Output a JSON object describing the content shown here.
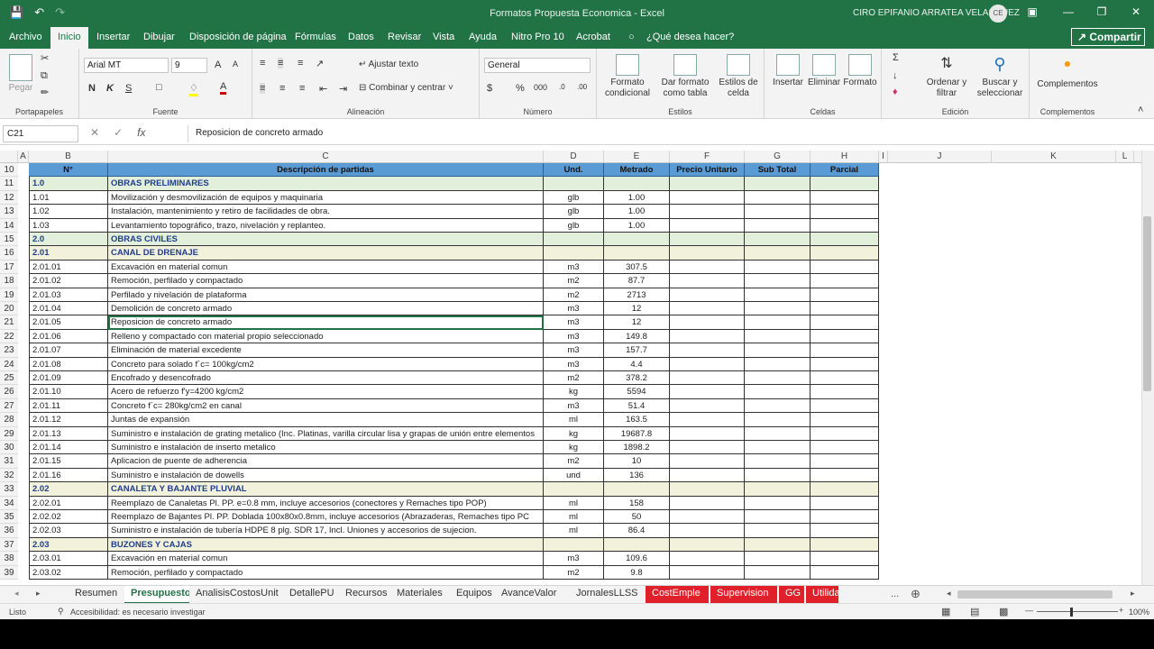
{
  "window": {
    "title": "Formatos Propuesta Economica  -  Excel",
    "user": "CIRO EPIFANIO ARRATEA VELASQUEZ",
    "initials": "CE"
  },
  "tabs": [
    "Archivo",
    "Inicio",
    "Insertar",
    "Dibujar",
    "Disposición de página",
    "Fórmulas",
    "Datos",
    "Revisar",
    "Vista",
    "Ayuda",
    "Nitro Pro 10",
    "Acrobat",
    "¿Qué desea hacer?"
  ],
  "share": "Compartir",
  "ribbon": {
    "clipboard": {
      "paste": "Pegar",
      "label": "Portapapeles"
    },
    "font": {
      "name": "Arial MT",
      "size": "9",
      "bold": "N",
      "italic": "K",
      "underline": "S",
      "label": "Fuente"
    },
    "align": {
      "wrap": "Ajustar texto",
      "merge": "Combinar y centrar",
      "label": "Alineación"
    },
    "number": {
      "format": "General",
      "label": "Número"
    },
    "styles": {
      "cond": "Formato condicional",
      "table": "Dar formato como tabla",
      "cell": "Estilos de celda",
      "label": "Estilos"
    },
    "cells": {
      "insert": "Insertar",
      "delete": "Eliminar",
      "format": "Formato",
      "label": "Celdas"
    },
    "editing": {
      "sort": "Ordenar y filtrar",
      "find": "Buscar y seleccionar",
      "label": "Edición"
    },
    "addins": {
      "btn": "Complementos",
      "label": "Complementos"
    }
  },
  "namebox": "C21",
  "formula": "Reposicion de concreto armado",
  "columns": [
    "A",
    "B",
    "C",
    "D",
    "E",
    "F",
    "G",
    "H",
    "I",
    "J",
    "K",
    "L"
  ],
  "header": {
    "num": "N°",
    "desc": "Descripción de partidas",
    "und": "Und.",
    "met": "Metrado",
    "pu": "Precio Unitario",
    "st": "Sub Total",
    "par": "Parcial"
  },
  "rows": [
    {
      "r": "11",
      "n": "1.0",
      "d": "OBRAS PRELIMINARES",
      "u": "",
      "m": "",
      "t": "sec"
    },
    {
      "r": "12",
      "n": "1.01",
      "d": "Movilización y desmovilización de equipos y maquinaria",
      "u": "glb",
      "m": "1.00",
      "t": ""
    },
    {
      "r": "13",
      "n": "1.02",
      "d": "Instalación, mantenimiento y retiro de facilidades de obra.",
      "u": "glb",
      "m": "1.00",
      "t": ""
    },
    {
      "r": "14",
      "n": "1.03",
      "d": "Levantamiento topográfico, trazo, nivelación y replanteo.",
      "u": "glb",
      "m": "1.00",
      "t": ""
    },
    {
      "r": "15",
      "n": "2.0",
      "d": "OBRAS CIVILES",
      "u": "",
      "m": "",
      "t": "sec"
    },
    {
      "r": "16",
      "n": "2.01",
      "d": "CANAL DE DRENAJE",
      "u": "",
      "m": "",
      "t": "sub"
    },
    {
      "r": "17",
      "n": "2.01.01",
      "d": "Excavación en material comun",
      "u": "m3",
      "m": "307.5",
      "t": ""
    },
    {
      "r": "18",
      "n": "2.01.02",
      "d": "Remoción, perfilado y compactado",
      "u": "m2",
      "m": "87.7",
      "t": ""
    },
    {
      "r": "19",
      "n": "2.01.03",
      "d": "Perfilado y nivelación de plataforma",
      "u": "m2",
      "m": "2713",
      "t": ""
    },
    {
      "r": "20",
      "n": "2.01.04",
      "d": "Demolición de concreto armado",
      "u": "m3",
      "m": "12",
      "t": ""
    },
    {
      "r": "21",
      "n": "2.01.05",
      "d": "Reposicion de concreto armado",
      "u": "m3",
      "m": "12",
      "t": ""
    },
    {
      "r": "22",
      "n": "2.01.06",
      "d": "Relleno y compactado con material propio seleccionado",
      "u": "m3",
      "m": "149.8",
      "t": ""
    },
    {
      "r": "23",
      "n": "2.01.07",
      "d": "Eliminación de material excedente",
      "u": "m3",
      "m": "157.7",
      "t": ""
    },
    {
      "r": "24",
      "n": "2.01.08",
      "d": "Concreto para solado f´c= 100kg/cm2",
      "u": "m3",
      "m": "4.4",
      "t": ""
    },
    {
      "r": "25",
      "n": "2.01.09",
      "d": "Encofrado y desencofrado",
      "u": "m2",
      "m": "378.2",
      "t": ""
    },
    {
      "r": "26",
      "n": "2.01.10",
      "d": "Acero de refuerzo f'y=4200 kg/cm2",
      "u": "kg",
      "m": "5594",
      "t": ""
    },
    {
      "r": "27",
      "n": "2.01.11",
      "d": "Concreto f´c= 280kg/cm2 en canal",
      "u": "m3",
      "m": "51.4",
      "t": ""
    },
    {
      "r": "28",
      "n": "2.01.12",
      "d": "Juntas de expansión",
      "u": "ml",
      "m": "163.5",
      "t": ""
    },
    {
      "r": "29",
      "n": "2.01.13",
      "d": "Suministro e instalación de grating metalico (Inc. Platinas, varilla circular lisa y grapas de unión entre elementos",
      "u": "kg",
      "m": "19687.8",
      "t": ""
    },
    {
      "r": "30",
      "n": "2.01.14",
      "d": "Suministro e instalación de inserto metalico",
      "u": "kg",
      "m": "1898.2",
      "t": ""
    },
    {
      "r": "31",
      "n": "2.01.15",
      "d": "Aplicacion de puente de adherencia",
      "u": "m2",
      "m": "10",
      "t": ""
    },
    {
      "r": "32",
      "n": "2.01.16",
      "d": "Suministro e instalación de dowells",
      "u": "und",
      "m": "136",
      "t": ""
    },
    {
      "r": "33",
      "n": "2.02",
      "d": "CANALETA Y BAJANTE PLUVIAL",
      "u": "",
      "m": "",
      "t": "sub"
    },
    {
      "r": "34",
      "n": "2.02.01",
      "d": "Reemplazo de Canaletas Pl. PP. e=0.8 mm, incluye accesorios (conectores y Remaches tipo POP)",
      "u": "ml",
      "m": "158",
      "t": ""
    },
    {
      "r": "35",
      "n": "2.02.02",
      "d": "Reemplazo de Bajantes Pl. PP. Doblada 100x80x0.8mm, incluye accesorios (Abrazaderas, Remaches tipo PC",
      "u": "ml",
      "m": "50",
      "t": ""
    },
    {
      "r": "36",
      "n": "2.02.03",
      "d": "Suministro e instalación de tubería HDPE 8 plg. SDR 17, Incl. Uniones y accesorios de sujecion.",
      "u": "ml",
      "m": "86.4",
      "t": ""
    },
    {
      "r": "37",
      "n": "2.03",
      "d": "BUZONES Y CAJAS",
      "u": "",
      "m": "",
      "t": "sub"
    },
    {
      "r": "38",
      "n": "2.03.01",
      "d": "Excavación en material comun",
      "u": "m3",
      "m": "109.6",
      "t": ""
    },
    {
      "r": "39",
      "n": "2.03.02",
      "d": "Remoción, perfilado y compactado",
      "u": "m2",
      "m": "9.8",
      "t": ""
    }
  ],
  "sheets": [
    "Resumen",
    "Presupuesto",
    "AnalisisCostosUnit",
    "DetallePU",
    "Recursos",
    "Materiales",
    "Equipos",
    "AvanceValor",
    "JornalesLLSS",
    "CostEmple",
    "Supervision",
    "GG",
    "Utilida"
  ],
  "status": {
    "ready": "Listo",
    "access": "Accesibilidad: es necesario investigar",
    "zoom": "100%"
  }
}
